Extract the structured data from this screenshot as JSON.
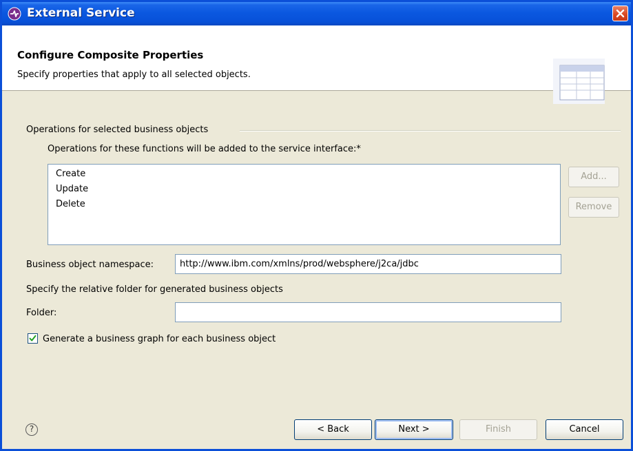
{
  "window": {
    "title": "External Service",
    "icons": {
      "app": "adapter-wizard-icon",
      "close": "close-icon"
    }
  },
  "header": {
    "title": "Configure Composite Properties",
    "description": "Specify properties that apply to all selected objects.",
    "graphic": "table-graphic"
  },
  "operations": {
    "group_label": "Operations for selected business objects",
    "list_label": "Operations for these functions will be added to the service interface:*",
    "items": [
      "Create",
      "Update",
      "Delete"
    ],
    "add_label": "Add...",
    "remove_label": "Remove"
  },
  "namespace": {
    "label": "Business object namespace:",
    "value": "http://www.ibm.com/xmlns/prod/websphere/j2ca/jdbc"
  },
  "folder": {
    "description": "Specify the relative folder for generated business objects",
    "label": "Folder:",
    "value": ""
  },
  "business_graph": {
    "label": "Generate a business graph for each business object",
    "checked": true
  },
  "footer": {
    "help_icon": "help-icon",
    "back_label": "< Back",
    "next_label": "Next >",
    "finish_label": "Finish",
    "cancel_label": "Cancel"
  },
  "colors": {
    "titlebar": "#0b58e0",
    "dialog_bg": "#ece9d8",
    "field_border": "#7f9db9",
    "close_button": "#d9461f"
  }
}
